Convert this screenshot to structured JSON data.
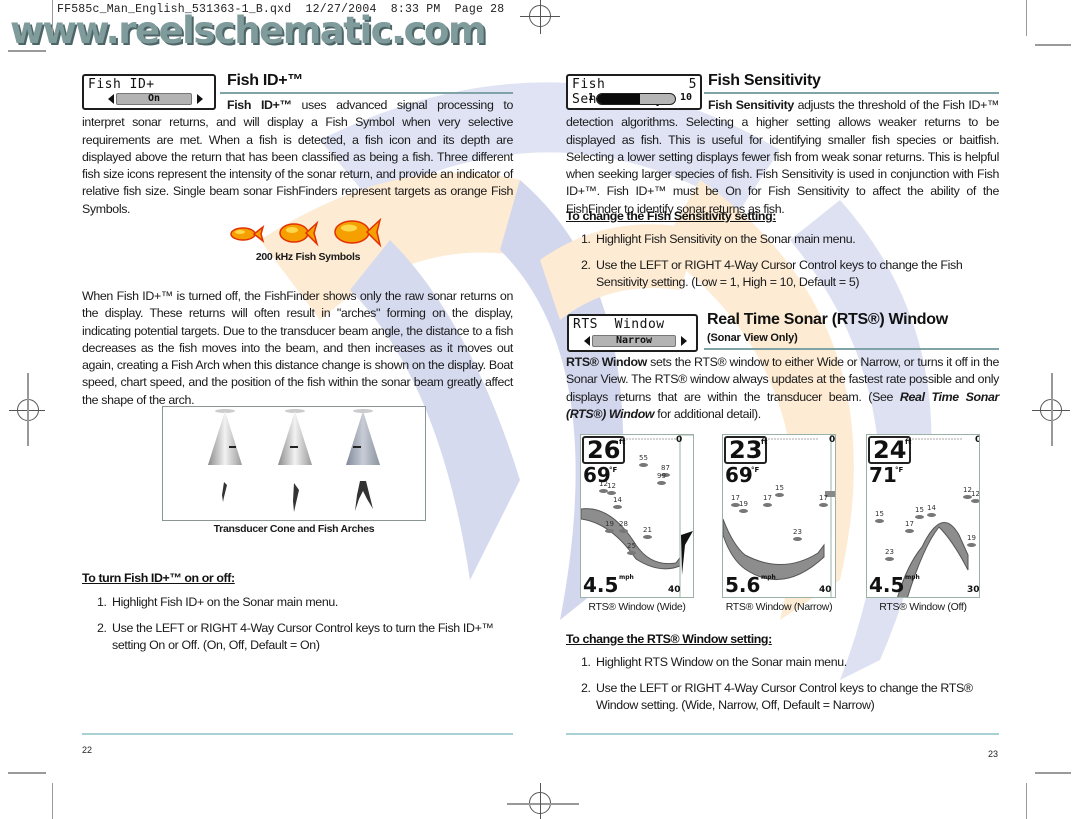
{
  "slug_line": "FF585c_Man_English_531363-1_B.qxd  12/27/2004  8:33 PM  Page 28",
  "watermark_site": "www.reelschematic.com",
  "left_page": {
    "page_number": "22",
    "fish_id_menu": {
      "title": "Fish ID+",
      "value": "On"
    },
    "fish_id_heading": "Fish ID+™",
    "fish_id_lead_bold": "Fish ID+™",
    "fish_id_paragraph": " uses advanced signal processing to interpret sonar returns, and will display a Fish Symbol when very selective requirements are met. When a fish is detected, a fish icon and its depth are displayed above the return that has been classified as being a fish.  Three different fish size icons represent  the intensity of the sonar return, and provide an indicator of relative fish size. Single beam sonar FishFinders represent targets as orange Fish Symbols.",
    "fish_symbols_caption": "200 kHz Fish Symbols",
    "fish_symbols": [
      {
        "size": "small",
        "color": "#f5a000"
      },
      {
        "size": "medium",
        "color": "#f5a000"
      },
      {
        "size": "large",
        "color": "#f5a000"
      }
    ],
    "arches_paragraph": "When Fish ID+™ is turned off, the FishFinder shows only the raw sonar returns on the display. These returns will often result in \"arches\" forming on the display, indicating potential targets. Due to the transducer beam angle, the distance to a fish decreases as the fish moves into the beam, and then increases as it moves out again, creating a Fish Arch when this distance change is shown on the display.  Boat speed, chart speed, and the position of the fish within the sonar beam greatly affect the shape of the arch.",
    "cone_figure_caption": "Transducer Cone and Fish Arches",
    "procedure_title": "To turn Fish ID+™ on or off:",
    "steps": [
      {
        "num": "1.",
        "text": "Highlight Fish ID+ on the Sonar main menu."
      },
      {
        "num": "2.",
        "text": "Use the LEFT or RIGHT 4-Way Cursor Control keys to turn the Fish ID+™ setting On or Off. (On, Off, Default = On)"
      }
    ]
  },
  "right_page": {
    "page_number": "23",
    "sensitivity_menu": {
      "title": "Fish Sensitivity",
      "value": "5",
      "min_label": "1",
      "max_label": "10",
      "level_fraction": 0.55
    },
    "sensitivity_heading": "Fish Sensitivity",
    "sensitivity_lead_bold": "Fish Sensitivity",
    "sensitivity_paragraph": " adjusts the threshold of the Fish ID+™ detection algorithms.  Selecting a higher setting allows weaker returns to be displayed as fish.  This is useful for identifying smaller fish species or baitfish.  Selecting a lower setting displays fewer fish from weak sonar returns.  This is helpful when seeking larger species of fish. Fish Sensitivity is used in conjunction with Fish ID+™. Fish ID+™ must be On for Fish Sensitivity to affect the ability of the FishFinder to identify sonar returns as fish.",
    "sensitivity_procedure_title": "To change the Fish Sensitivity setting:",
    "sensitivity_steps": [
      {
        "num": "1.",
        "text": "Highlight Fish Sensitivity on the Sonar main menu."
      },
      {
        "num": "2.",
        "text": "Use the LEFT or RIGHT 4-Way Cursor Control keys to change the Fish Sensitivity setting. (Low = 1, High = 10, Default = 5)"
      }
    ],
    "rts_menu": {
      "title": "RTS  Window",
      "value": "Narrow"
    },
    "rts_heading": "Real Time Sonar (RTS®) Window",
    "rts_subheading": "(Sonar View Only)",
    "rts_lead_bold": "RTS® Window",
    "rts_paragraph_a": " sets the RTS® window to either Wide or Narrow, or turns it off in the Sonar View. The RTS® window always updates at the fastest rate possible and only displays returns that are within the transducer beam. (See ",
    "rts_paragraph_italic": "Real Time Sonar (RTS®) Window",
    "rts_paragraph_b": " for additional detail).",
    "screens": [
      {
        "caption": "RTS® Window (Wide)",
        "depth": "26",
        "depth_unit": "ft",
        "temp": "69",
        "temp_unit": "°F",
        "speed": "4.5",
        "speed_unit": "mph",
        "top_range": "0",
        "bottom_range": "40",
        "fish_depths": [
          "12",
          "12",
          "14",
          "19",
          "28",
          "21",
          "25",
          "55",
          "87",
          "99"
        ]
      },
      {
        "caption": "RTS® Window (Narrow)",
        "depth": "23",
        "depth_unit": "ft",
        "temp": "69",
        "temp_unit": "°F",
        "speed": "5.6",
        "speed_unit": "mph",
        "top_range": "0",
        "bottom_range": "40",
        "fish_depths": [
          "17",
          "19",
          "17",
          "15",
          "17",
          "23"
        ]
      },
      {
        "caption": "RTS® Window (Off)",
        "depth": "24",
        "depth_unit": "ft",
        "temp": "71",
        "temp_unit": "°F",
        "speed": "4.5",
        "speed_unit": "mph",
        "top_range": "0",
        "bottom_range": "30",
        "fish_depths": [
          "15",
          "15",
          "14",
          "17",
          "12",
          "12",
          "19",
          "23"
        ]
      }
    ],
    "rts_procedure_title": "To change the RTS® Window setting:",
    "rts_steps": [
      {
        "num": "1.",
        "text": "Highlight RTS Window on the Sonar main menu."
      },
      {
        "num": "2.",
        "text": "Use the LEFT or RIGHT 4-Way Cursor Control keys to change the RTS® Window setting. (Wide, Narrow, Off, Default = Narrow)"
      }
    ]
  },
  "colors": {
    "heading_rule": "#7fa3a6",
    "footer_rule": "#a9d0d3",
    "fish_symbol": "#f5a000",
    "watermark_blue": "#c9cde8",
    "watermark_orange": "#fde3c0"
  }
}
